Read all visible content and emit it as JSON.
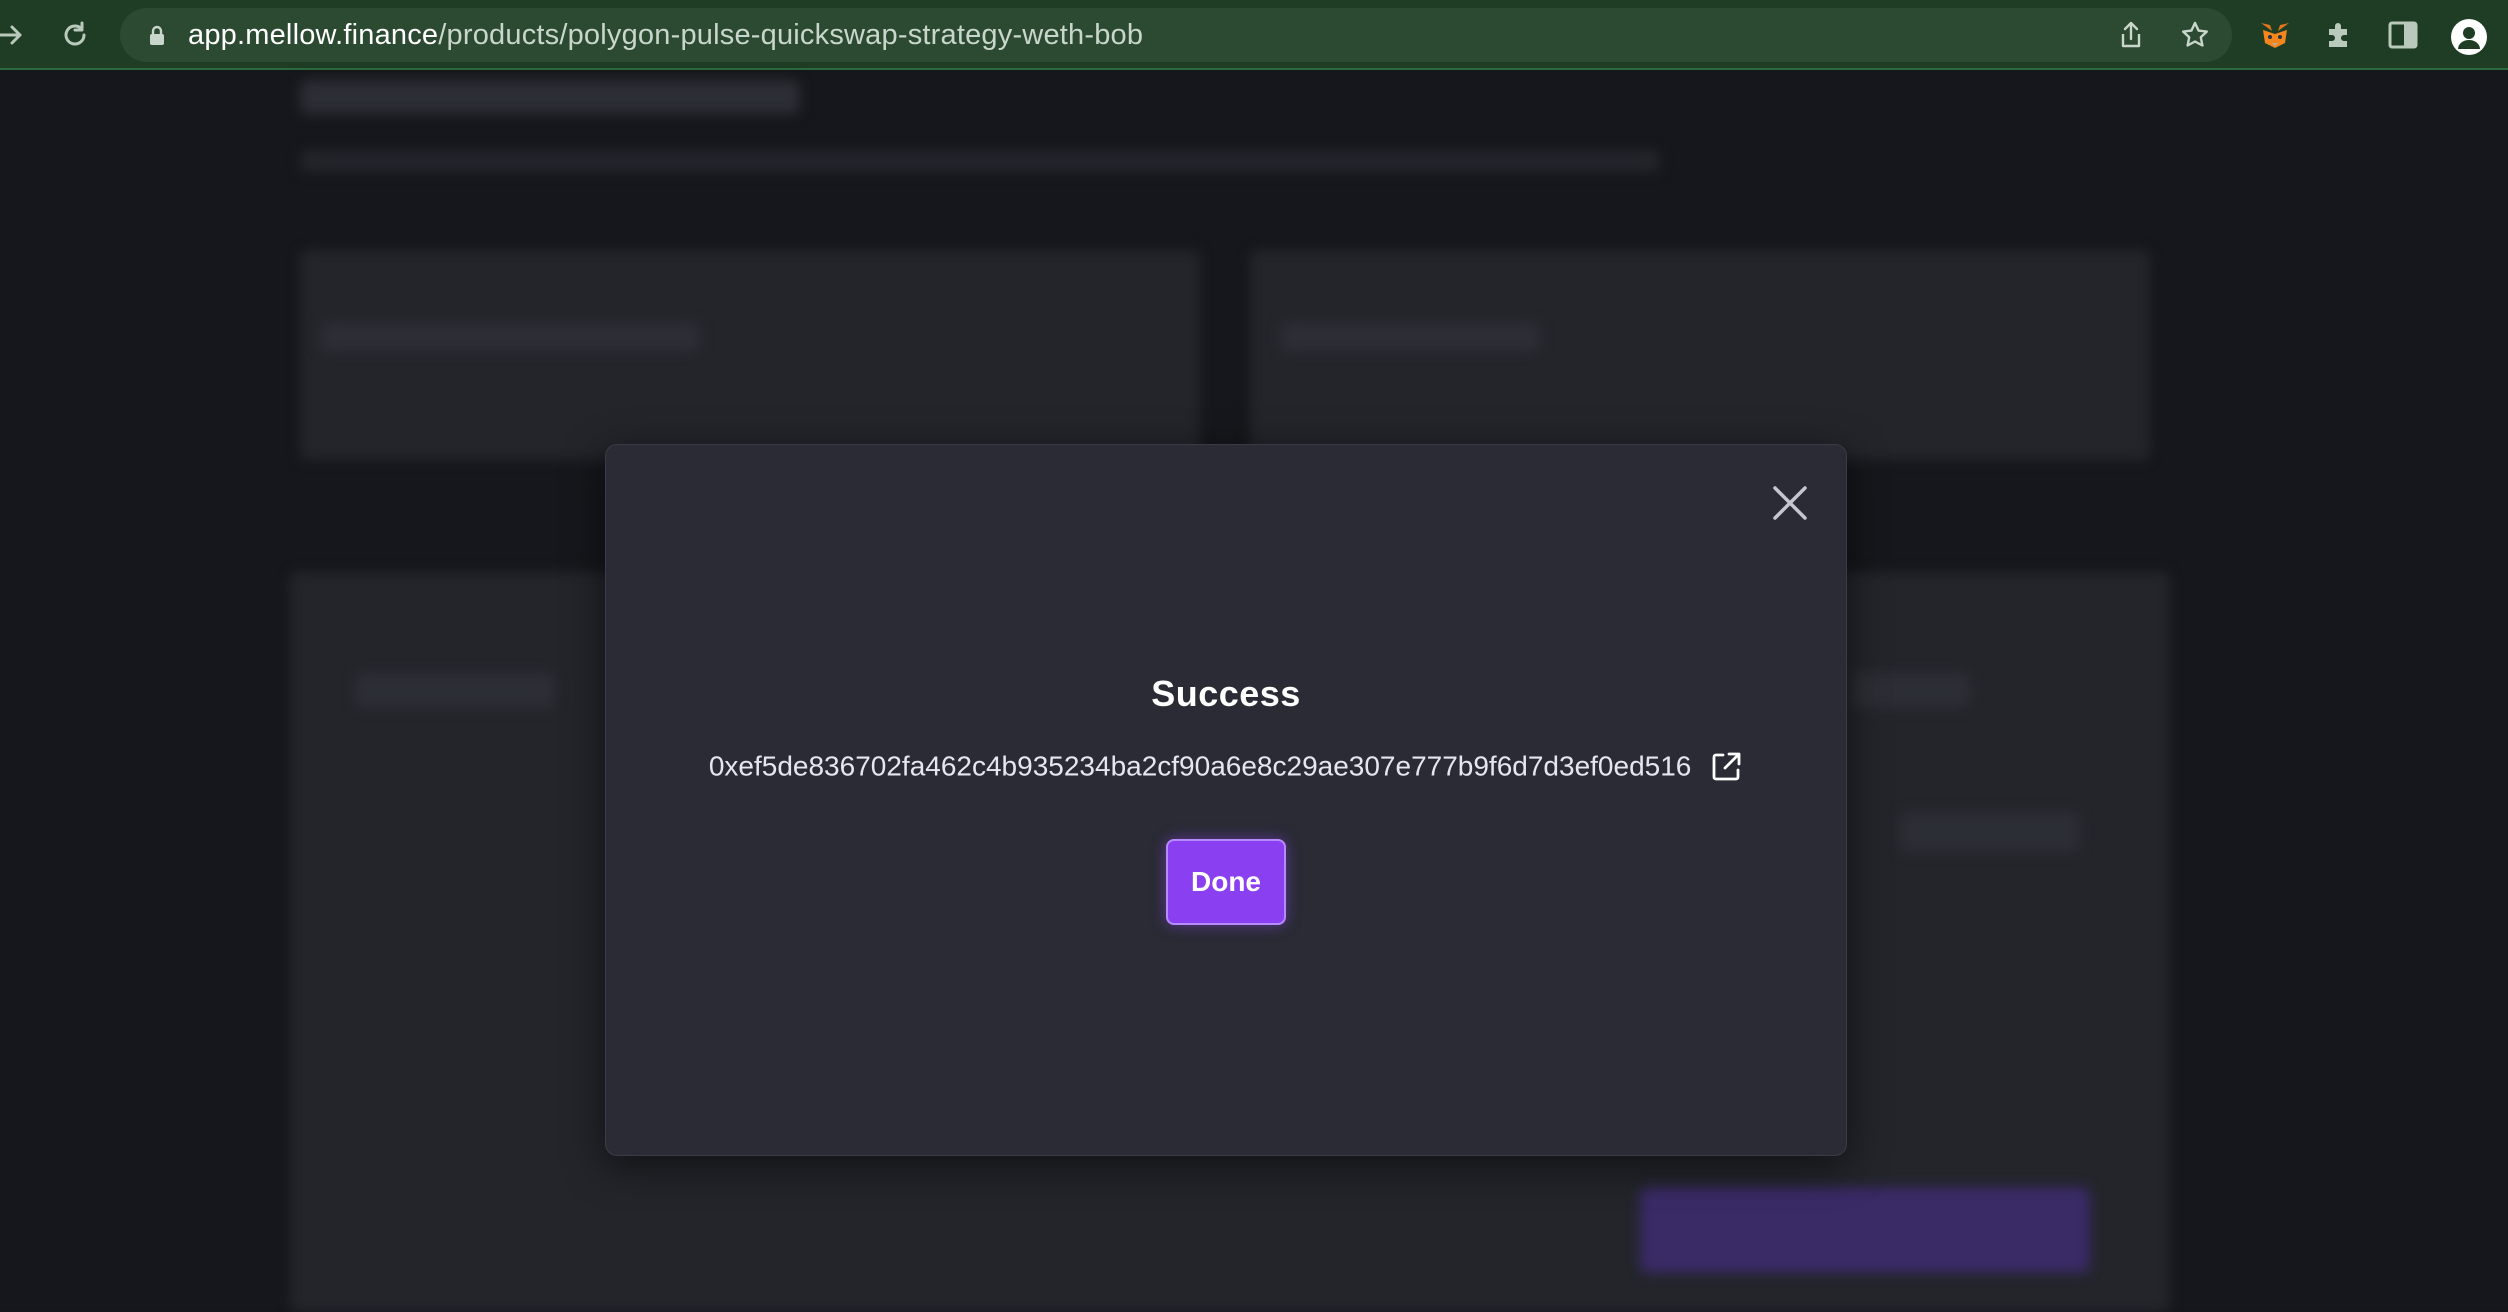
{
  "browser": {
    "url_host": "app.mellow.finance",
    "url_path": "/products/polygon-pulse-quickswap-strategy-weth-bob",
    "toolbar_color": "#1f3d25",
    "icons": [
      "forward-icon",
      "reload-icon",
      "lock-icon",
      "share-icon",
      "bookmark-star-icon",
      "metamask-fox-icon",
      "extensions-puzzle-icon",
      "side-panel-icon",
      "profile-icon"
    ]
  },
  "modal": {
    "title": "Success",
    "tx_hash": "0xef5de836702fa462c4b935234ba2cf90a6e8c29ae307e777b9f6d7d3ef0ed516",
    "done_label": "Done",
    "accent_color": "#8a3ff0",
    "icons": [
      "close-icon",
      "external-link-icon"
    ]
  }
}
